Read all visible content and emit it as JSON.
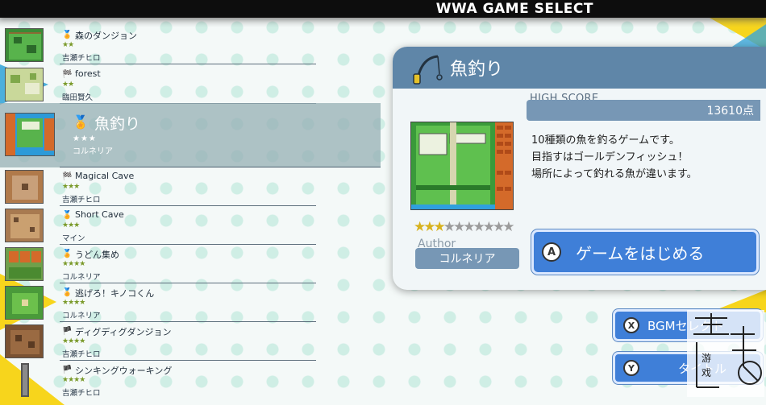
{
  "header": {
    "title": "WWA GAME SELECT"
  },
  "games": [
    {
      "title": "森のダンジョン",
      "medal": "gold-medal",
      "stars": "★★",
      "author": "吉瀬チヒロ"
    },
    {
      "title": "forest",
      "medal": "checkered-flag",
      "stars": "★★",
      "author": "臨田賢久"
    },
    {
      "title": "魚釣り",
      "medal": "gold-medal",
      "stars": "★★★",
      "author": "コルネリア",
      "selected": true
    },
    {
      "title": "Magical Cave",
      "medal": "checkered-flag",
      "stars": "★★★",
      "author": "吉瀬チヒロ"
    },
    {
      "title": "Short Cave",
      "medal": "gold-medal",
      "stars": "★★★",
      "author": "マイン"
    },
    {
      "title": "うどん集め",
      "medal": "gold-medal",
      "stars": "★★★★",
      "author": "コルネリア"
    },
    {
      "title": "逃げろ！キノコくん",
      "medal": "gold-medal",
      "stars": "★★★★",
      "author": "コルネリア"
    },
    {
      "title": "ディグディグダンジョン",
      "medal": "flag",
      "stars": "★★★★",
      "author": "吉瀬チヒロ"
    },
    {
      "title": "シンキングウォーキング",
      "medal": "flag",
      "stars": "★★★★",
      "author": "吉瀬チヒロ"
    }
  ],
  "detail": {
    "title": "魚釣り",
    "icon": "fishing-rod-icon",
    "high_score_label": "HIGH SCORE",
    "high_score_value": "13610点",
    "description_lines": [
      "10種類の魚を釣るゲームです。",
      "目指すはゴールデンフィッシュ！",
      "場所によって釣れる魚が違います。"
    ],
    "rating_filled": 3,
    "rating_total": 10,
    "author_label": "Author",
    "author_name": "コルネリア",
    "start_button_key": "A",
    "start_button_label": "ゲームをはじめる"
  },
  "side_buttons": [
    {
      "key": "X",
      "label": "BGMセレクト"
    },
    {
      "key": "Y",
      "label": "タイトル"
    }
  ],
  "colors": {
    "accent": "#3f7fd8",
    "panel_header": "#5f86a8",
    "deco_yellow": "#f7d51c",
    "deco_blue": "#3aa6d8"
  }
}
